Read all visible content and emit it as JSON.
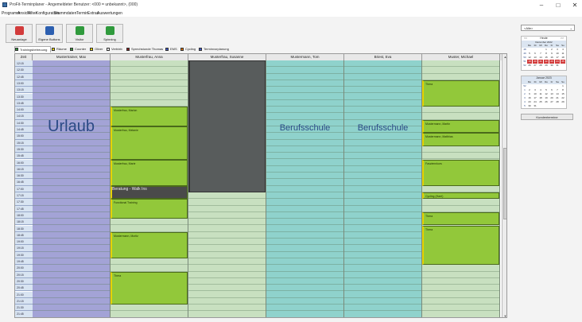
{
  "window": {
    "title": "ProFit-Terminplaner - Angemeldeter Benutzer: <000 = unbekannt>, (000)",
    "minimize": "–",
    "maximize": "□",
    "close": "✕"
  },
  "menu": [
    "Programm",
    "Ansicht",
    "Filter",
    "Konfiguration",
    "Stammdaten",
    "Termin",
    "Extras",
    "Auswertungen"
  ],
  "toolbar": [
    {
      "label": "Neuanlage",
      "icon": "new-calendar-icon",
      "color": "#d23b3b"
    },
    {
      "label": "Eigene Buttons",
      "icon": "custom-buttons-icon",
      "color": "#2c5fb0"
    },
    {
      "label": "Visitor",
      "icon": "add-visitor-icon",
      "color": "#2f9a3c"
    },
    {
      "label": "Spinning",
      "icon": "add-spinning-icon",
      "color": "#2f9a3c"
    }
  ],
  "legend": [
    {
      "label": "Trainingsbetreuung",
      "color": "#2f9a3c",
      "active": true
    },
    {
      "label": "Räume",
      "color": "#e6d200",
      "active": false
    },
    {
      "label": "Counter",
      "color": "#3f9a3c",
      "active": false
    },
    {
      "label": "Oliver",
      "color": "#e6d200",
      "active": false
    },
    {
      "label": "Vertrieb",
      "color": "#f0f0f0",
      "active": false
    },
    {
      "label": "Sprechstunde Thomas",
      "color": "#8a1b1b",
      "active": false
    },
    {
      "label": "EMS",
      "color": "#3a56c8",
      "active": false
    },
    {
      "label": "Cycling",
      "color": "#d46a00",
      "active": false
    },
    {
      "label": "Terminvorplanung",
      "color": "#3a56c8",
      "active": false
    }
  ],
  "calendar": {
    "day_header": "Zeit",
    "times": [
      "12:15",
      "12:30",
      "12:45",
      "13:00",
      "13:15",
      "13:30",
      "13:45",
      "14:00",
      "14:15",
      "14:30",
      "14:45",
      "15:00",
      "15:15",
      "15:30",
      "15:45",
      "16:00",
      "16:15",
      "16:30",
      "16:45",
      "17:00",
      "17:15",
      "17:30",
      "17:45",
      "18:00",
      "18:15",
      "18:30",
      "18:45",
      "19:00",
      "19:15",
      "19:30",
      "19:45",
      "20:00",
      "20:15",
      "20:30",
      "20:45",
      "21:00",
      "21:15",
      "21:30",
      "21:45"
    ],
    "columns": [
      {
        "name": "Mustertrainer, Max",
        "bg": "#a3a3d6",
        "big_label": "Urlaub",
        "appts": []
      },
      {
        "name": "Musterfrau, Anna",
        "bg": "#c8e0c0",
        "big_label": "",
        "appts": [
          {
            "label": "Musterfrau, Marion",
            "start": 7,
            "end": 10,
            "kind": "appt"
          },
          {
            "label": "Musterfrau, Melanie",
            "start": 10,
            "end": 15,
            "kind": "appt"
          },
          {
            "label": "Musterfrau, Marie",
            "start": 15,
            "end": 19,
            "kind": "appt"
          },
          {
            "label": "Beratung - Walk Ins",
            "start": 19,
            "end": 21,
            "kind": "dark"
          },
          {
            "label": "Functional Training",
            "start": 21,
            "end": 24,
            "kind": "appt"
          },
          {
            "label": "Mustermann, Moritz",
            "start": 26,
            "end": 30,
            "kind": "appt"
          },
          {
            "label": "Thera",
            "start": 32,
            "end": 37,
            "kind": "appt"
          }
        ]
      },
      {
        "name": "Musterfrau, Susanne",
        "bg": "#c8e0c0",
        "big_label": "",
        "appts": [
          {
            "label": "",
            "start": 0,
            "end": 20,
            "kind": "blocked"
          }
        ]
      },
      {
        "name": "Mustermann, Tom",
        "bg": "#8fd2cc",
        "big_label": "Berufsschule",
        "appts": []
      },
      {
        "name": "Briest, Eva",
        "bg": "#8fd2cc",
        "big_label": "Berufsschule",
        "appts": []
      },
      {
        "name": "Muster, Michael",
        "bg": "#c8e0c0",
        "big_label": "",
        "appts": [
          {
            "label": "Thera",
            "start": 3,
            "end": 7,
            "kind": "appt"
          },
          {
            "label": "Mustermann, Martin",
            "start": 9,
            "end": 11,
            "kind": "appt"
          },
          {
            "label": "Mustermann, Matthias",
            "start": 11,
            "end": 13,
            "kind": "appt"
          },
          {
            "label": "Fasziennkurs",
            "start": 15,
            "end": 19,
            "kind": "appt"
          },
          {
            "label": "Cycling (Harri)",
            "start": 20,
            "end": 21,
            "kind": "appt"
          },
          {
            "label": "Thera",
            "start": 23,
            "end": 25,
            "kind": "appt"
          },
          {
            "label": "Thera",
            "start": 25,
            "end": 31,
            "kind": "appt"
          }
        ]
      }
    ]
  },
  "right_panel": {
    "filter_value": "<Alle>",
    "month1": {
      "name": "Dezember 2022",
      "nav_prev": "<<",
      "nav_label": "Heute",
      "nav_next": ">>",
      "weekdays": [
        "Mo",
        "Di",
        "Mi",
        "Do",
        "Fr",
        "Sa",
        "So"
      ],
      "weeks": [
        "48",
        "49",
        "50",
        "51",
        "52"
      ],
      "days": [
        [
          "",
          "",
          "",
          "1",
          "2",
          "3",
          "4"
        ],
        [
          "5",
          "6",
          "7",
          "8",
          "9",
          "10",
          "11"
        ],
        [
          "12",
          "13",
          "14",
          "15",
          "16",
          "17",
          "18"
        ],
        [
          "19",
          "20",
          "21",
          "22",
          "23",
          "24",
          "25"
        ],
        [
          "26",
          "27",
          "28",
          "29",
          "30",
          "31",
          ""
        ]
      ]
    },
    "month2": {
      "name": "Januar 2023",
      "weekdays": [
        "Mo",
        "Di",
        "Mi",
        "Do",
        "Fr",
        "Sa",
        "So"
      ],
      "weeks": [
        "52",
        "1",
        "2",
        "3",
        "4",
        "5"
      ],
      "days": [
        [
          "",
          "",
          "",
          "",
          "",
          "",
          "1"
        ],
        [
          "2",
          "3",
          "4",
          "5",
          "6",
          "7",
          "8"
        ],
        [
          "9",
          "10",
          "11",
          "12",
          "13",
          "14",
          "15"
        ],
        [
          "16",
          "17",
          "18",
          "19",
          "20",
          "21",
          "22"
        ],
        [
          "23",
          "24",
          "25",
          "26",
          "27",
          "28",
          "29"
        ],
        [
          "30",
          "31",
          "",
          "",
          "",
          "",
          ""
        ]
      ]
    },
    "customer_button": "Kundentermine"
  },
  "colors": {
    "accent_red": "#d23b3b",
    "appt_green": "#92c83a",
    "appt_stripe": "#e6d200"
  }
}
